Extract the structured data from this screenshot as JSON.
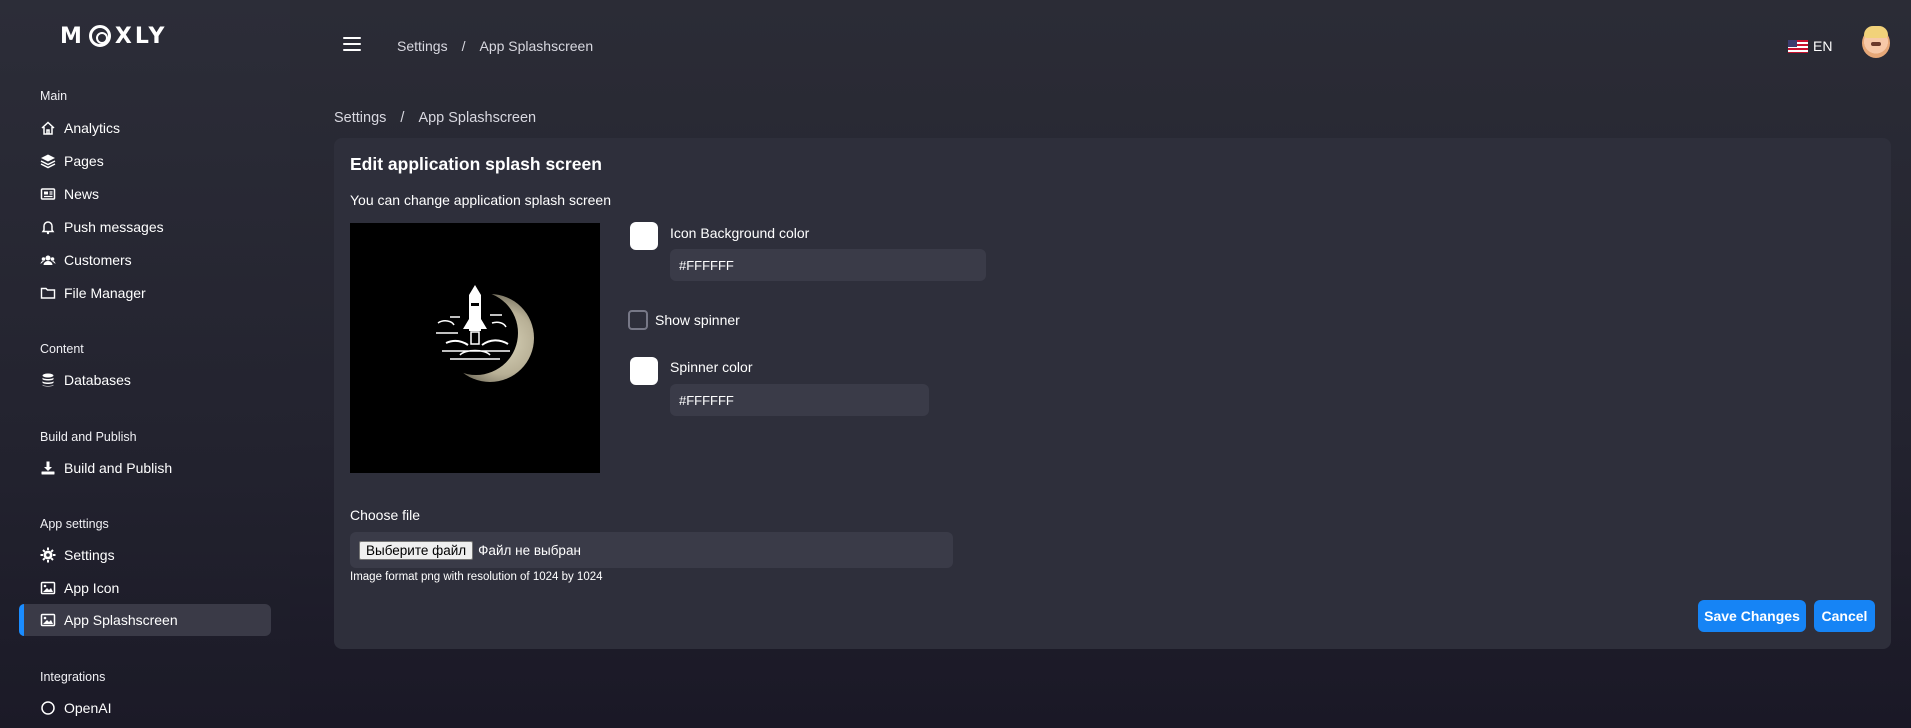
{
  "brand": {
    "logo_text_left": "M",
    "logo_text_right": "XLY"
  },
  "header": {
    "breadcrumb": [
      "Settings",
      "/",
      "App Splashscreen"
    ],
    "language": "EN"
  },
  "sidebar": {
    "sections": [
      {
        "title": "Main",
        "items": [
          {
            "label": "Analytics",
            "icon": "home-icon"
          },
          {
            "label": "Pages",
            "icon": "layers-icon"
          },
          {
            "label": "News",
            "icon": "newspaper-icon"
          },
          {
            "label": "Push messages",
            "icon": "bell-icon"
          },
          {
            "label": "Customers",
            "icon": "users-icon"
          },
          {
            "label": "File Manager",
            "icon": "folder-icon"
          }
        ]
      },
      {
        "title": "Content",
        "items": [
          {
            "label": "Databases",
            "icon": "database-icon"
          }
        ]
      },
      {
        "title": "Build and Publish",
        "items": [
          {
            "label": "Build and Publish",
            "icon": "download-icon"
          }
        ]
      },
      {
        "title": "App settings",
        "items": [
          {
            "label": "Settings",
            "icon": "gear-icon"
          },
          {
            "label": "App Icon",
            "icon": "image-icon"
          },
          {
            "label": "App Splashscreen",
            "icon": "image-icon",
            "active": true
          }
        ]
      },
      {
        "title": "Integrations",
        "items": [
          {
            "label": "OpenAI",
            "icon": "openai-icon"
          }
        ]
      }
    ]
  },
  "page": {
    "breadcrumb": [
      "Settings",
      "/",
      "App Splashscreen"
    ],
    "title": "Edit application splash screen",
    "subtitle": "You can change application splash screen",
    "icon_bg": {
      "label": "Icon Background color",
      "value": "#FFFFFF"
    },
    "show_spinner": {
      "label": "Show spinner",
      "checked": false
    },
    "spinner_color": {
      "label": "Spinner color",
      "value": "#FFFFFF"
    },
    "file": {
      "label": "Choose file",
      "button_label": "Выберите файл",
      "status": "Файл не выбран",
      "hint": "Image format png with resolution of 1024 by 1024"
    },
    "save_label": "Save Changes",
    "cancel_label": "Cancel"
  },
  "colors": {
    "accent": "#1684f5",
    "card": "#2e2f3b",
    "input": "#3a3b48"
  }
}
